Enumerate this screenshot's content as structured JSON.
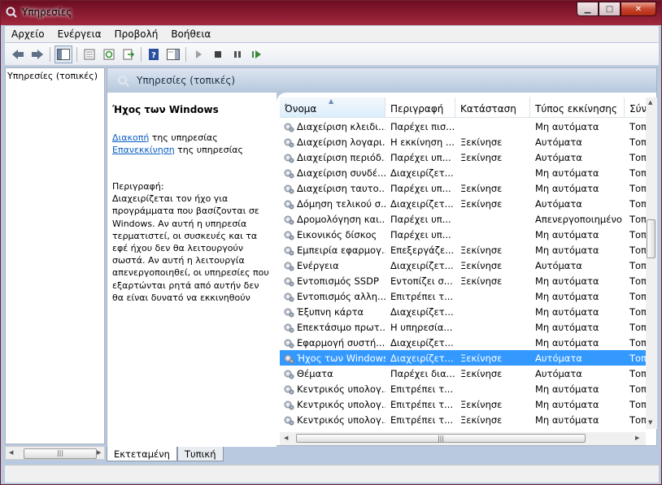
{
  "window": {
    "title": "Υπηρεσίες",
    "minimize": "0",
    "maximize": "□",
    "close": "✕"
  },
  "menu": [
    "Αρχείο",
    "Ενέργεια",
    "Προβολή",
    "Βοήθεια"
  ],
  "toolbar_icons": [
    "back-icon",
    "forward-icon",
    "show-hide-tree-icon",
    "properties-icon",
    "refresh-icon",
    "export-list-icon",
    "help-icon",
    "show-hide-action-pane-icon",
    "start-service-icon",
    "stop-service-icon",
    "pause-service-icon",
    "restart-service-icon"
  ],
  "tree": {
    "root": "Υπηρεσίες (τοπικές)"
  },
  "main": {
    "header_title": "Υπηρεσίες (τοπικές)",
    "service_title": "Ήχος των Windows",
    "stop_link": "Διακοπή",
    "stop_suffix": " της υπηρεσίας",
    "restart_link": "Επανεκκίνηση",
    "restart_suffix": " της υπηρεσίας",
    "desc_label": "Περιγραφή:",
    "description": "Διαχειρίζεται τον ήχο για προγράμματα που βασίζονται σε Windows. Αν αυτή η υπηρεσία τερματιστεί, οι συσκευές και τα εφέ ήχου δεν θα λειτουργούν σωστά. Αν αυτή η λειτουργία απενεργοποιηθεί, οι υπηρεσίες που εξαρτώνται ρητά από αυτήν δεν θα είναι δυνατό να εκκινηθούν"
  },
  "columns": [
    "Όνομα",
    "Περιγραφή",
    "Κατάσταση",
    "Τύπος εκκίνησης",
    "Σύν"
  ],
  "rows": [
    {
      "name": "Διαχείριση κλειδι...",
      "desc": "Παρέχει πισ...",
      "status": "",
      "startup": "Μη αυτόματα",
      "logon": "Τοπ"
    },
    {
      "name": "Διαχείριση λογαρι...",
      "desc": "Η εκκίνηση ...",
      "status": "Ξεκίνησε",
      "startup": "Αυτόματα",
      "logon": "Τοπ"
    },
    {
      "name": "Διαχείριση περιόδ...",
      "desc": "Παρέχει υπ...",
      "status": "Ξεκίνησε",
      "startup": "Αυτόματα",
      "logon": "Τοπ"
    },
    {
      "name": "Διαχείριση συνδέ...",
      "desc": "Διαχειρίζετ...",
      "status": "",
      "startup": "Μη αυτόματα",
      "logon": "Τοπ"
    },
    {
      "name": "Διαχείριση ταυτο...",
      "desc": "Παρέχει υπ...",
      "status": "Ξεκίνησε",
      "startup": "Μη αυτόματα",
      "logon": "Τοπ"
    },
    {
      "name": "Δόμηση τελικού σ...",
      "desc": "Διαχειρίζετ...",
      "status": "Ξεκίνησε",
      "startup": "Αυτόματα",
      "logon": "Τοπ"
    },
    {
      "name": "Δρομολόγηση και...",
      "desc": "Παρέχει υπ...",
      "status": "",
      "startup": "Απενεργοποιημένο",
      "logon": "Τοπ"
    },
    {
      "name": "Εικονικός δίσκος",
      "desc": "Παρέχει υπ...",
      "status": "",
      "startup": "Μη αυτόματα",
      "logon": "Τοπ"
    },
    {
      "name": "Εμπειρία εφαρμογ...",
      "desc": "Επεξεργάζε...",
      "status": "Ξεκίνησε",
      "startup": "Μη αυτόματα",
      "logon": "Τοπ"
    },
    {
      "name": "Ενέργεια",
      "desc": "Διαχειρίζετ...",
      "status": "Ξεκίνησε",
      "startup": "Αυτόματα",
      "logon": "Τοπ"
    },
    {
      "name": "Εντοπισμός SSDP",
      "desc": "Εντοπίζει σ...",
      "status": "Ξεκίνησε",
      "startup": "Μη αυτόματα",
      "logon": "Τοπ"
    },
    {
      "name": "Εντοπισμός αλλη...",
      "desc": "Επιτρέπει τ...",
      "status": "",
      "startup": "Μη αυτόματα",
      "logon": "Τοπ"
    },
    {
      "name": "Έξυπνη κάρτα",
      "desc": "Διαχειρίζετ...",
      "status": "",
      "startup": "Μη αυτόματα",
      "logon": "Τοπ"
    },
    {
      "name": "Επεκτάσιμο πρωτ...",
      "desc": "Η υπηρεσία...",
      "status": "",
      "startup": "Μη αυτόματα",
      "logon": "Τοπ"
    },
    {
      "name": "Εφαρμογή συστή...",
      "desc": "Διαχειρίζετ...",
      "status": "",
      "startup": "Μη αυτόματα",
      "logon": "Τοπ"
    },
    {
      "name": "Ήχος των Windows",
      "desc": "Διαχειρίζετ...",
      "status": "Ξεκίνησε",
      "startup": "Αυτόματα",
      "logon": "Τοπ",
      "selected": true
    },
    {
      "name": "Θέματα",
      "desc": "Παρέχει δια...",
      "status": "Ξεκίνησε",
      "startup": "Αυτόματα",
      "logon": "Τοπ"
    },
    {
      "name": "Κεντρικός υπολογ...",
      "desc": "Επιτρέπει τ...",
      "status": "",
      "startup": "Μη αυτόματα",
      "logon": "Τοπ"
    },
    {
      "name": "Κεντρικός υπολογ...",
      "desc": "Επιτρέπει τ...",
      "status": "Ξεκίνησε",
      "startup": "Μη αυτόματα",
      "logon": "Τοπ"
    },
    {
      "name": "Κεντρικός υπολογ...",
      "desc": "Επιτρέπει τ...",
      "status": "Ξεκίνησε",
      "startup": "Μη αυτόματα",
      "logon": "Τοπ"
    },
    {
      "name": "Κεντρικός υπολογ...",
      "desc": "Η υπηρεσία...",
      "status": "Ξεκίνησε",
      "startup": "Μη αυτόματα",
      "logon": "Τοπ"
    }
  ],
  "tabs": [
    "Εκτεταμένη",
    "Τυπική"
  ]
}
